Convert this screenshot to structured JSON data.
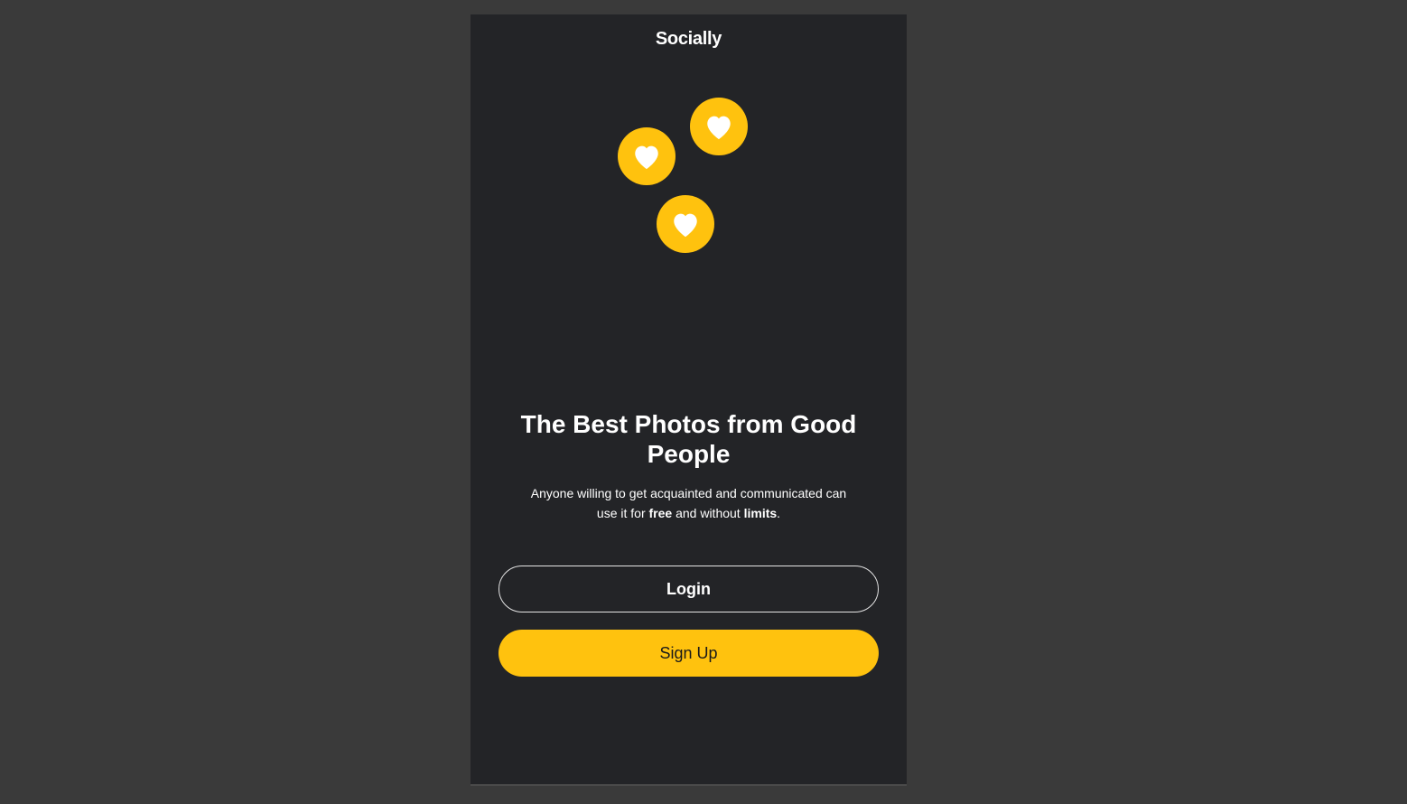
{
  "app": {
    "title": "Socially"
  },
  "illustration": {
    "icons": [
      "heart-icon",
      "heart-icon",
      "heart-icon"
    ],
    "badge_color": "#ffc20e",
    "heart_color": "#ffffff"
  },
  "hero": {
    "headline": "The Best Photos from Good People",
    "subtext_part1": "Anyone willing to get acquainted and communicated can use it for ",
    "subtext_bold1": "free",
    "subtext_part2": " and without ",
    "subtext_bold2": "limits",
    "subtext_part3": "."
  },
  "actions": {
    "login_label": "Login",
    "signup_label": "Sign Up"
  },
  "colors": {
    "page_background": "#3a3a3a",
    "screen_background": "#232427",
    "accent": "#ffc20e"
  }
}
